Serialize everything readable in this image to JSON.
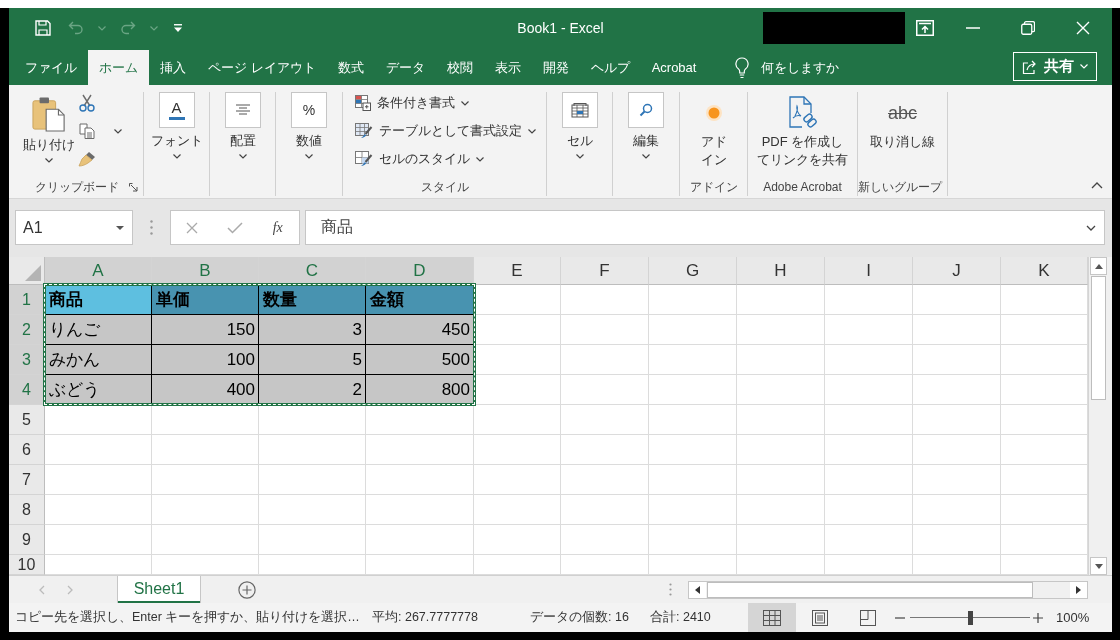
{
  "title_bar": {
    "quick_access": [
      {
        "kind": "save",
        "disabled": false
      },
      {
        "kind": "undo",
        "disabled": true
      },
      {
        "kind": "undo_menu",
        "disabled": true
      },
      {
        "kind": "redo",
        "disabled": true
      },
      {
        "kind": "redo_menu",
        "disabled": true
      },
      {
        "kind": "customize",
        "disabled": false
      }
    ],
    "title": "Book1 - Excel"
  },
  "tabs": [
    {
      "label": "ファイル",
      "selected": false
    },
    {
      "label": "ホーム",
      "selected": true
    },
    {
      "label": "挿入",
      "selected": false
    },
    {
      "label": "ページ レイアウト",
      "selected": false
    },
    {
      "label": "数式",
      "selected": false
    },
    {
      "label": "データ",
      "selected": false
    },
    {
      "label": "校閲",
      "selected": false
    },
    {
      "label": "表示",
      "selected": false
    },
    {
      "label": "開発",
      "selected": false
    },
    {
      "label": "ヘルプ",
      "selected": false
    },
    {
      "label": "Acrobat",
      "selected": false
    }
  ],
  "tell_me": {
    "label": "何をしますか"
  },
  "share_button": {
    "label": "共有"
  },
  "ribbon": {
    "groups": [
      {
        "kind": "clipboard",
        "label": "クリップボード",
        "paste_label": "貼り付け"
      },
      {
        "kind": "font",
        "button": "フォント",
        "icon_text": "A"
      },
      {
        "kind": "alignment",
        "button": "配置"
      },
      {
        "kind": "number",
        "button": "数値",
        "icon_text": "%"
      },
      {
        "kind": "styles",
        "label": "スタイル",
        "items": [
          "条件付き書式",
          "テーブルとして書式設定",
          "セルのスタイル"
        ]
      },
      {
        "kind": "cells",
        "button": "セル"
      },
      {
        "kind": "editing",
        "button": "編集"
      },
      {
        "kind": "addins",
        "label": "アドイン",
        "button_lines": [
          "アド",
          "イン"
        ]
      },
      {
        "kind": "acrobat",
        "label": "Adobe Acrobat",
        "button_lines": [
          "PDF を作成し",
          "てリンクを共有"
        ]
      },
      {
        "kind": "strikethrough",
        "label": "新しいグループ",
        "icon_text": "abc",
        "button_lines": [
          "取り消し線"
        ]
      }
    ]
  },
  "formula_bar": {
    "name_box": "A1",
    "insert_function": "fx",
    "formula": "商品"
  },
  "grid": {
    "columns": [
      {
        "label": "A",
        "selected": true
      },
      {
        "label": "B",
        "selected": true
      },
      {
        "label": "C",
        "selected": true
      },
      {
        "label": "D",
        "selected": true
      },
      {
        "label": "E",
        "selected": false
      },
      {
        "label": "F",
        "selected": false
      },
      {
        "label": "G",
        "selected": false
      },
      {
        "label": "H",
        "selected": false
      },
      {
        "label": "I",
        "selected": false
      },
      {
        "label": "J",
        "selected": false
      },
      {
        "label": "K",
        "selected": false
      }
    ],
    "copy_marquee": true,
    "rows": [
      {
        "label": "1",
        "selected": true,
        "cells": [
          {
            "text": "商品",
            "kind": "heading",
            "selected": true,
            "active": true
          },
          {
            "text": "単価",
            "kind": "heading",
            "selected": true,
            "active": false
          },
          {
            "text": "数量",
            "kind": "heading",
            "selected": true,
            "active": false
          },
          {
            "text": "金額",
            "kind": "heading",
            "selected": true,
            "active": false
          }
        ]
      },
      {
        "label": "2",
        "selected": true,
        "cells": [
          {
            "text": "りんご",
            "kind": "text",
            "selected": true,
            "active": false
          },
          {
            "text": "150",
            "kind": "number",
            "selected": true,
            "active": false
          },
          {
            "text": "3",
            "kind": "number",
            "selected": true,
            "active": false
          },
          {
            "text": "450",
            "kind": "number",
            "selected": true,
            "active": false
          }
        ]
      },
      {
        "label": "3",
        "selected": true,
        "cells": [
          {
            "text": "みかん",
            "kind": "text",
            "selected": true,
            "active": false
          },
          {
            "text": "100",
            "kind": "number",
            "selected": true,
            "active": false
          },
          {
            "text": "5",
            "kind": "number",
            "selected": true,
            "active": false
          },
          {
            "text": "500",
            "kind": "number",
            "selected": true,
            "active": false
          }
        ]
      },
      {
        "label": "4",
        "selected": true,
        "cells": [
          {
            "text": "ぶどう",
            "kind": "text",
            "selected": true,
            "active": false
          },
          {
            "text": "400",
            "kind": "number",
            "selected": true,
            "active": false
          },
          {
            "text": "2",
            "kind": "number",
            "selected": true,
            "active": false
          },
          {
            "text": "800",
            "kind": "number",
            "selected": true,
            "active": false
          }
        ]
      },
      {
        "label": "5",
        "selected": false
      },
      {
        "label": "6",
        "selected": false
      },
      {
        "label": "7",
        "selected": false
      },
      {
        "label": "8",
        "selected": false
      },
      {
        "label": "9",
        "selected": false
      },
      {
        "label": "10",
        "selected": false
      }
    ]
  },
  "sheet_tabs": [
    {
      "label": "Sheet1",
      "selected": true
    }
  ],
  "status_bar": {
    "message": "コピー先を選択し、Enter キーを押すか、貼り付けを選択…",
    "average": "平均: 267.7777778",
    "count": "データの個数: 16",
    "sum": "合計: 2410",
    "views": [
      {
        "kind": "normal",
        "selected": true
      },
      {
        "kind": "page_layout",
        "selected": false
      },
      {
        "kind": "page_break",
        "selected": false
      }
    ],
    "zoom": {
      "level": 0.5,
      "reading": "100%"
    }
  }
}
